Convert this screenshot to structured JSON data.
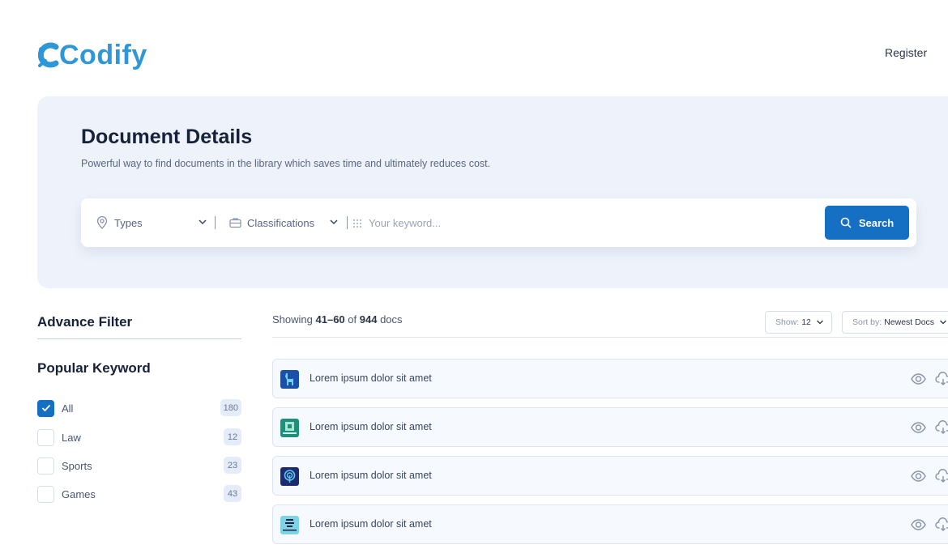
{
  "header": {
    "logo_text": "Codify",
    "register_label": "Register"
  },
  "hero": {
    "title": "Document Details",
    "subtitle": "Powerful way to find documents in the library which saves time and ultimately reduces cost."
  },
  "search": {
    "types_label": "Types",
    "classifications_label": "Classifications",
    "keyword_placeholder": "Your keyword...",
    "button_label": "Search"
  },
  "sidebar": {
    "advance_filter_title": "Advance Filter",
    "popular_keyword_title": "Popular Keyword",
    "keywords": [
      {
        "label": "All",
        "count": "180",
        "checked": true
      },
      {
        "label": "Law",
        "count": "12",
        "checked": false
      },
      {
        "label": "Sports",
        "count": "23",
        "checked": false
      },
      {
        "label": "Games",
        "count": "43",
        "checked": false
      }
    ]
  },
  "results": {
    "showing_prefix": "Showing",
    "range": "41–60",
    "of_word": "of",
    "total": "944",
    "unit": "docs",
    "show_label": "Show:",
    "show_value": "12",
    "sort_label": "Sort by:",
    "sort_value": "Newest Docs"
  },
  "documents": [
    {
      "title": "Lorem ipsum dolor sit amet",
      "icon": "llama-logo-icon",
      "icon_color": "#1c4fa8"
    },
    {
      "title": "Lorem ipsum dolor sit amet",
      "icon": "book-logo-icon",
      "icon_color": "#1f8f7a"
    },
    {
      "title": "Lorem ipsum dolor sit amet",
      "icon": "fingerprint-logo-icon",
      "icon_color": "#1e2a6e"
    },
    {
      "title": "Lorem ipsum dolor sit amet",
      "icon": "stack-logo-icon",
      "icon_color": "#7dd3e8"
    }
  ],
  "colors": {
    "brand": "#2d97d7",
    "primary_button": "#156fc2",
    "hero_bg": "#eef3fb"
  }
}
